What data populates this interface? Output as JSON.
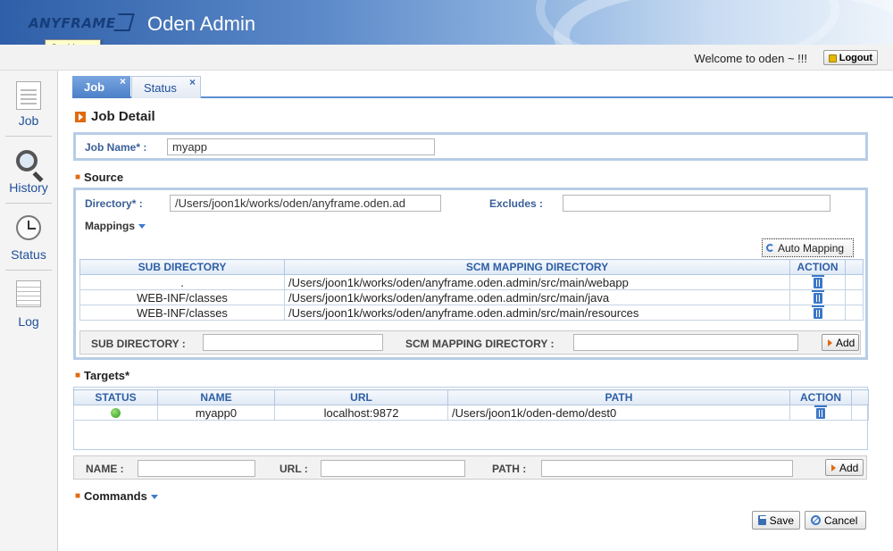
{
  "header": {
    "logo": "ANYFRAME",
    "title": "Oden Admin",
    "tooltip": "Go Home"
  },
  "topbar": {
    "welcome": "Welcome to oden ~ !!!",
    "logout": "Logout"
  },
  "sidebar": {
    "items": [
      {
        "label": "Job",
        "icon": "document-icon"
      },
      {
        "label": "History",
        "icon": "magnifier-icon"
      },
      {
        "label": "Status",
        "icon": "clock-icon"
      },
      {
        "label": "Log",
        "icon": "log-sheet-icon"
      }
    ]
  },
  "tabs": [
    {
      "label": "Job",
      "active": true
    },
    {
      "label": "Status",
      "active": false
    }
  ],
  "tab_close": "×",
  "page_title": "Job Detail",
  "job": {
    "name_label": "Job Name* :",
    "name_value": "myapp"
  },
  "source": {
    "section_label": "Source",
    "directory_label": "Directory* :",
    "directory_value": "/Users/joon1k/works/oden/anyframe.oden.ad",
    "excludes_label": "Excludes :",
    "excludes_value": "",
    "mappings_label": "Mappings",
    "auto_mapping": "Auto Mapping",
    "table": {
      "headers": [
        "SUB DIRECTORY",
        "SCM MAPPING DIRECTORY",
        "ACTION"
      ],
      "rows": [
        [
          ".",
          "/Users/joon1k/works/oden/anyframe.oden.admin/src/main/webapp"
        ],
        [
          "WEB-INF/classes",
          "/Users/joon1k/works/oden/anyframe.oden.admin/src/main/java"
        ],
        [
          "WEB-INF/classes",
          "/Users/joon1k/works/oden/anyframe.oden.admin/src/main/resources"
        ]
      ]
    },
    "form": {
      "sub_label": "SUB DIRECTORY :",
      "scm_label": "SCM MAPPING DIRECTORY :",
      "add": "Add"
    }
  },
  "targets": {
    "section_label": "Targets*",
    "table": {
      "headers": [
        "STATUS",
        "NAME",
        "URL",
        "PATH",
        "ACTION"
      ],
      "rows": [
        {
          "status": "online",
          "name": "myapp0",
          "url": "localhost:9872",
          "path": "/Users/joon1k/oden-demo/dest0"
        }
      ]
    },
    "form": {
      "name_label": "NAME :",
      "url_label": "URL :",
      "path_label": "PATH :",
      "add": "Add"
    }
  },
  "commands": {
    "section_label": "Commands"
  },
  "actions": {
    "save": "Save",
    "cancel": "Cancel"
  },
  "colors": {
    "accent": "#5b8ed0",
    "brand": "#2f5fa8",
    "status_ok": "#2c9a1a",
    "orange": "#e06a10"
  }
}
